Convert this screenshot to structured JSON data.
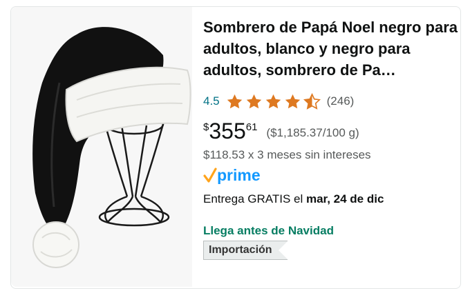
{
  "product": {
    "title": "Sombrero de Papá Noel negro para adultos, blanco y negro para adultos, sombrero de Pa…",
    "image_label": "Sombrero de Papá Noel negro sobre soporte de alambre",
    "rating": {
      "value": "4.5",
      "stars": 4.5,
      "reviews": "(246)"
    },
    "price": {
      "currency": "$",
      "whole": "355",
      "fraction": "61",
      "unit_price": "($1,185.37/100 g)"
    },
    "installments": "$118.53 x 3 meses sin intereses",
    "prime": {
      "label": "prime",
      "icon": "prime-check-icon"
    },
    "delivery": {
      "prefix": "Entrega GRATIS el ",
      "date": "mar, 24 de dic"
    },
    "christmas": "Llega antes de Navidad",
    "badge": "Importación"
  },
  "colors": {
    "link": "#007185",
    "star": "#de7921",
    "green": "#067d62",
    "prime_blue": "#1399ff",
    "prime_orange": "#ffa41c"
  }
}
